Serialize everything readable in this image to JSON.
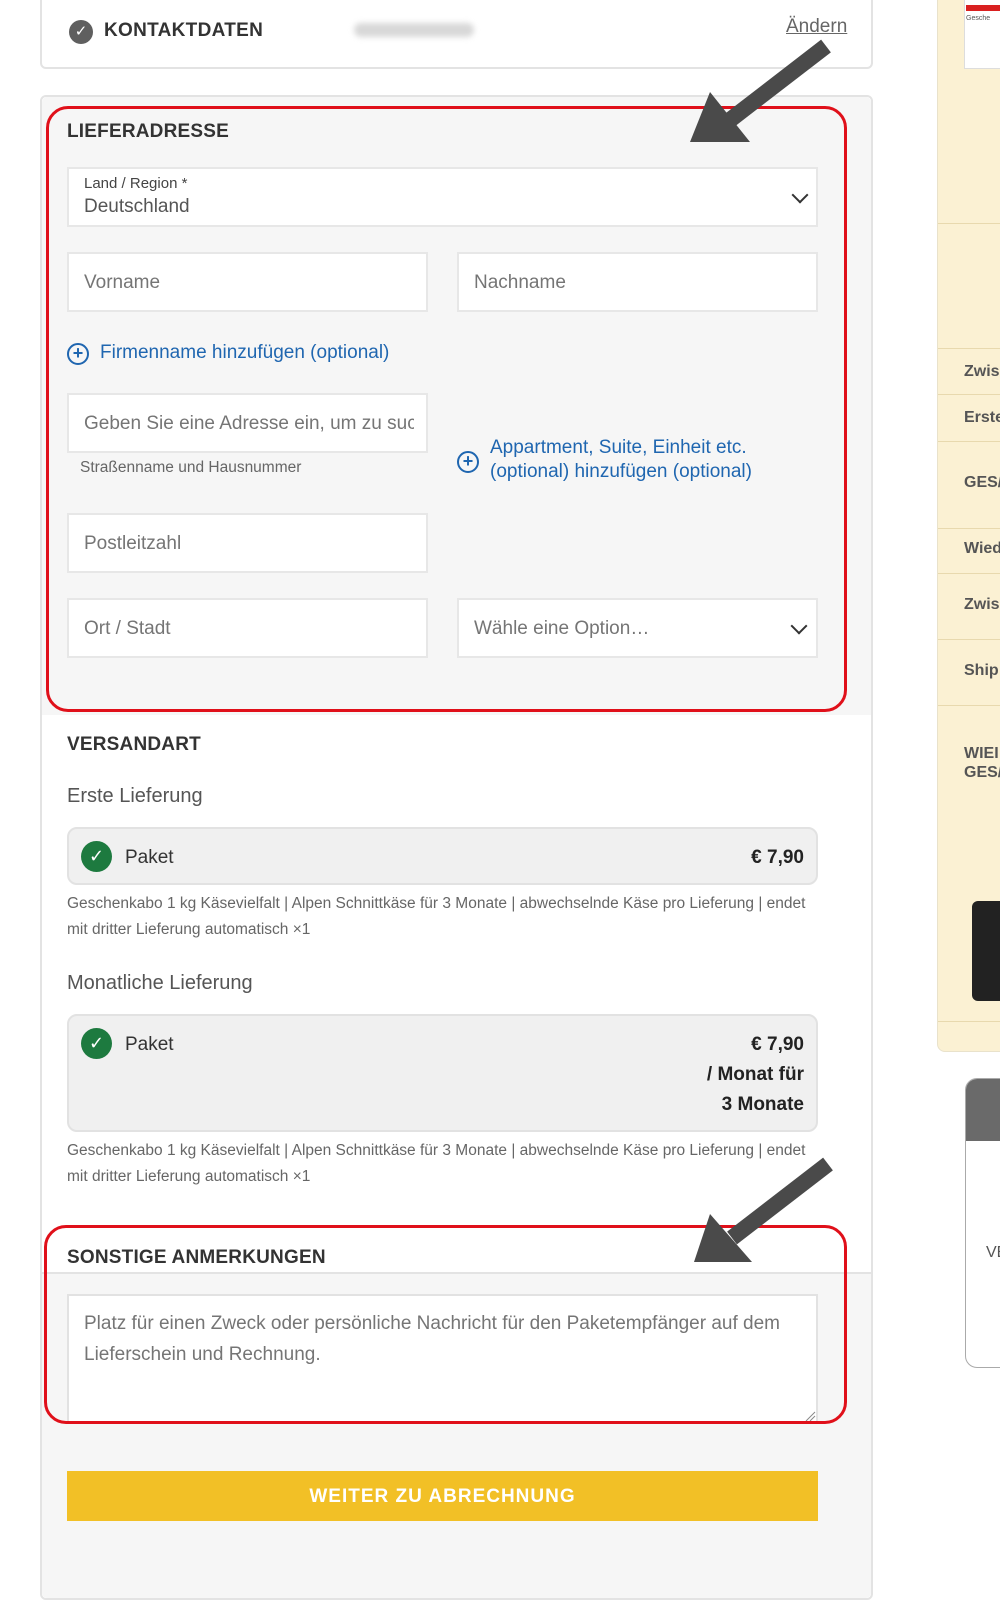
{
  "contact": {
    "title": "KONTAKTDATEN",
    "change_label": "Ändern"
  },
  "delivery_address": {
    "title": "LIEFERADRESSE",
    "country_label": "Land / Region *",
    "country_value": "Deutschland",
    "first_name_placeholder": "Vorname",
    "last_name_placeholder": "Nachname",
    "add_company_label": "Firmenname hinzufügen (optional)",
    "address_placeholder": "Geben Sie eine Adresse ein, um zu such",
    "address_hint": "Straßenname und Hausnummer",
    "add_apartment_label_line1": "Appartment, Suite, Einheit etc.",
    "add_apartment_label_line2": "(optional) hinzufügen (optional)",
    "postcode_placeholder": "Postleitzahl",
    "city_placeholder": "Ort / Stadt",
    "state_placeholder": "Wähle eine Option…"
  },
  "shipping": {
    "title": "VERSANDART",
    "first_delivery": {
      "label": "Erste Lieferung",
      "method": "Paket",
      "price": "€ 7,90",
      "description": "Geschenkabo 1 kg Käsevielfalt | Alpen Schnittkäse für 3 Monate | abwechselnde Käse pro Lieferung | endet mit dritter Lieferung automatisch ×1"
    },
    "monthly_delivery": {
      "label": "Monatliche Lieferung",
      "method": "Paket",
      "price_line1": "€ 7,90",
      "price_line2": "/ Monat für",
      "price_line3": "3 Monate",
      "description": "Geschenkabo 1 kg Käsevielfalt | Alpen Schnittkäse für 3 Monate | abwechselnde Käse pro Lieferung | endet mit dritter Lieferung automatisch ×1"
    }
  },
  "notes": {
    "title": "SONSTIGE ANMERKUNGEN",
    "placeholder": "Platz für einen Zweck oder persönliche Nachricht für den Paketempfänger auf dem Lieferschein und Rechnung."
  },
  "continue_button": "WEITER ZU ABRECHNUNG",
  "order_summary_sidebar": {
    "thumb_text": "Gesche",
    "labels": [
      "Zwis",
      "Erste",
      "GES/",
      "Wied",
      "Zwis",
      "Ship",
      "WIEI",
      "GES/"
    ],
    "box_text": "VE"
  },
  "colors": {
    "accent_yellow": "#f2c026",
    "link_blue": "#1f66b0",
    "success_green": "#1d7a3f",
    "annotation_red": "#e0101a"
  },
  "icons": [
    "check-circle-icon",
    "chevron-down-icon",
    "plus-circle-icon",
    "arrow-annotation-icon",
    "resize-handle-icon"
  ]
}
